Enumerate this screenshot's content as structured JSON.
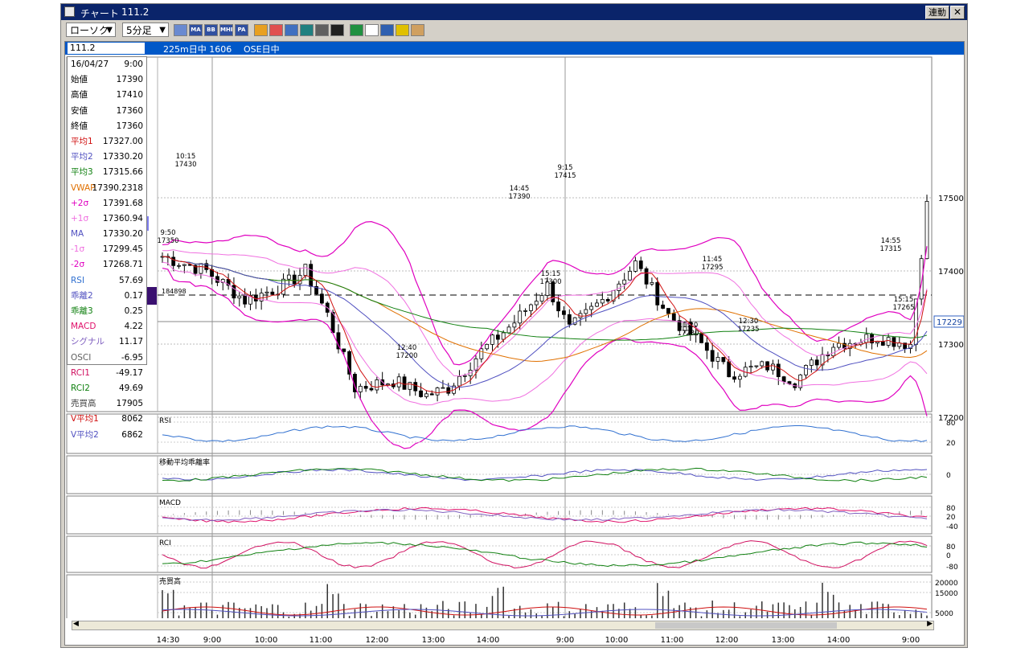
{
  "window": {
    "title": "チャート",
    "code": "111.2",
    "link_label": "連動",
    "close_label": "✕"
  },
  "toolbar": {
    "chart_type": "ローソク",
    "interval": "5分足",
    "tools": [
      "chart-type-icon",
      "ma-icon",
      "bb-icon",
      "mhe-icon",
      "pa-icon",
      "line-tool-icon",
      "fibo-icon",
      "wave-icon",
      "zoom-icon",
      "print-icon",
      "cross-icon",
      "pen-icon",
      "cursor-icon",
      "eraser-icon",
      "settings-icon",
      "dashboard-icon"
    ],
    "tool_texts": {
      "ma": "MA",
      "bb": "BB",
      "mhe": "MHE",
      "pa": "PA"
    }
  },
  "infobar": {
    "code": "111.2",
    "item1": "225m日中 1606",
    "item2": "OSE日中"
  },
  "datapanel": [
    {
      "k": "16/04/27",
      "v": "9:00",
      "c": "#000"
    },
    {
      "k": "始値",
      "v": "17390",
      "c": "#000"
    },
    {
      "k": "高値",
      "v": "17410",
      "c": "#000"
    },
    {
      "k": "安値",
      "v": "17360",
      "c": "#000"
    },
    {
      "k": "終値",
      "v": "17360",
      "c": "#000"
    },
    {
      "k": "平均1",
      "v": "17327.00",
      "c": "#d01010"
    },
    {
      "k": "平均2",
      "v": "17330.20",
      "c": "#5050c0"
    },
    {
      "k": "平均3",
      "v": "17315.66",
      "c": "#108010"
    },
    {
      "k": "VWAP",
      "v": "17390.2318",
      "c": "#e07000"
    },
    {
      "k": "+2σ",
      "v": "17391.68",
      "c": "#e000c0"
    },
    {
      "k": "+1σ",
      "v": "17360.94",
      "c": "#f070e0"
    },
    {
      "k": "MA",
      "v": "17330.20",
      "c": "#5050c0"
    },
    {
      "k": "-1σ",
      "v": "17299.45",
      "c": "#f070e0"
    },
    {
      "k": "-2σ",
      "v": "17268.71",
      "c": "#e000c0"
    },
    {
      "k": "RSI",
      "v": "57.69",
      "c": "#3070d0"
    },
    {
      "k": "乖離2",
      "v": "0.17",
      "c": "#5050c0"
    },
    {
      "k": "乖離3",
      "v": "0.25",
      "c": "#108010"
    },
    {
      "k": "MACD",
      "v": "4.22",
      "c": "#e0106a"
    },
    {
      "k": "シグナル",
      "v": "11.17",
      "c": "#8060c0"
    },
    {
      "k": "OSCI",
      "v": "-6.95",
      "c": "#606060"
    },
    {
      "k": "RCI1",
      "v": "-49.17",
      "c": "#d01060"
    },
    {
      "k": "RCI2",
      "v": "49.69",
      "c": "#108010"
    },
    {
      "k": "売買高",
      "v": "17905",
      "c": "#404040"
    },
    {
      "k": "V平均1",
      "v": "8062",
      "c": "#d01010"
    },
    {
      "k": "V平均2",
      "v": "6862",
      "c": "#5050c0"
    }
  ],
  "main_chart": {
    "price_ticks": [
      "17500",
      "17400",
      "17300",
      "17200"
    ],
    "current_price": "17229",
    "hline_label": "184898",
    "annotations": [
      {
        "t": "10:15",
        "p": "17430"
      },
      {
        "t": "9:50",
        "p": "17350"
      },
      {
        "t": "12:40",
        "p": "17200"
      },
      {
        "t": "14:45",
        "p": "17390"
      },
      {
        "t": "9:15",
        "p": "17415"
      },
      {
        "t": "15:15",
        "p": "17300"
      },
      {
        "t": "11:45",
        "p": "17295"
      },
      {
        "t": "11:20",
        "p": "17230"
      },
      {
        "t": "12:30",
        "p": "17235"
      },
      {
        "t": "14:55",
        "p": "17315"
      },
      {
        "t": "15:15",
        "p": "17265"
      }
    ]
  },
  "subpanels": {
    "rsi": {
      "label": "RSI",
      "ticks": [
        "80",
        "20"
      ]
    },
    "kairi": {
      "label": "移動平均乖離率",
      "ticks": [
        "0"
      ]
    },
    "macd": {
      "label": "MACD",
      "ticks": [
        "80",
        "20",
        "-40"
      ]
    },
    "rci": {
      "label": "RCI",
      "ticks": [
        "80",
        "0",
        "-80"
      ]
    },
    "volume": {
      "label": "売買高",
      "ticks": [
        "20000",
        "15000",
        "5000"
      ]
    }
  },
  "x_axis": [
    "14:30",
    "9:00",
    "10:00",
    "11:00",
    "12:00",
    "13:00",
    "14:00",
    "9:00",
    "10:00",
    "11:00",
    "12:00",
    "13:00",
    "14:00",
    "9:00"
  ],
  "colors": {
    "title_bg": "#0a246a",
    "info_bg": "#0058c8",
    "ma1": "#d01010",
    "ma2": "#5050c0",
    "ma3": "#108010",
    "vwap": "#e07000",
    "bb2": "#e000c0",
    "bb1": "#f070e0"
  }
}
